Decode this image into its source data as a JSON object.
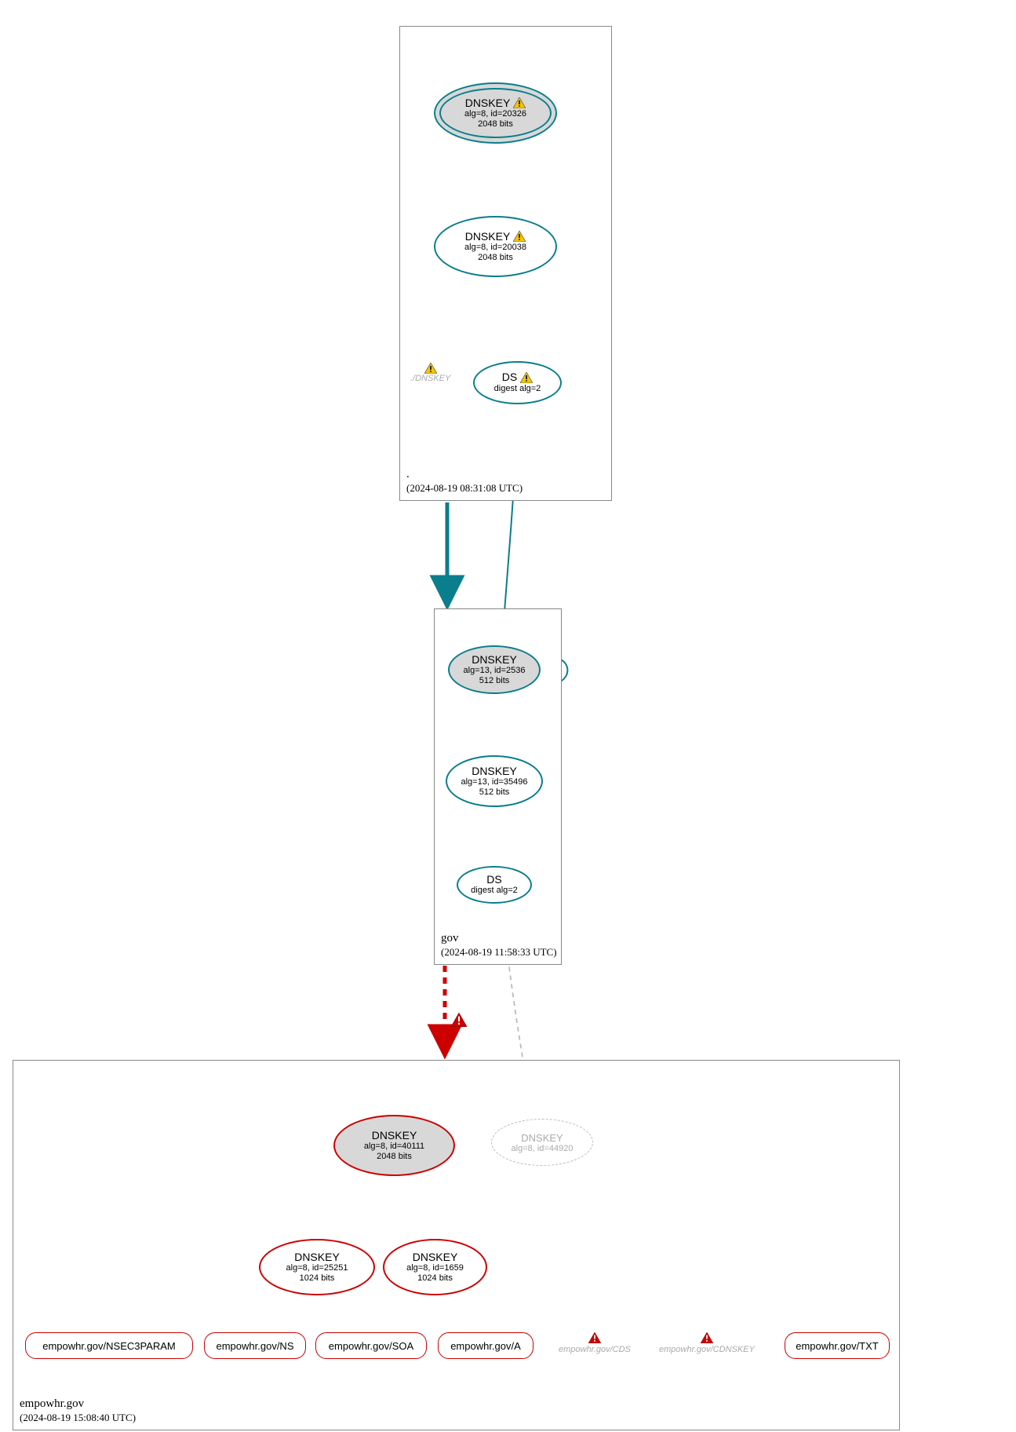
{
  "zones": {
    "root": {
      "name": ".",
      "timestamp": "(2024-08-19 08:31:08 UTC)"
    },
    "gov": {
      "name": "gov",
      "timestamp": "(2024-08-19 11:58:33 UTC)"
    },
    "empowhr": {
      "name": "empowhr.gov",
      "timestamp": "(2024-08-19 15:08:40 UTC)"
    }
  },
  "nodes": {
    "root_ksk": {
      "title": "DNSKEY",
      "line1": "alg=8, id=20326",
      "line2": "2048 bits",
      "warn": true
    },
    "root_zsk": {
      "title": "DNSKEY",
      "line1": "alg=8, id=20038",
      "line2": "2048 bits",
      "warn": true
    },
    "root_ds": {
      "title": "DS",
      "line1": "digest alg=2",
      "warn": true
    },
    "root_dnskey_label": "./DNSKEY",
    "gov_ksk": {
      "title": "DNSKEY",
      "line1": "alg=13, id=2536",
      "line2": "512 bits"
    },
    "gov_zsk": {
      "title": "DNSKEY",
      "line1": "alg=13, id=35496",
      "line2": "512 bits"
    },
    "gov_ds": {
      "title": "DS",
      "line1": "digest alg=2"
    },
    "emp_ksk": {
      "title": "DNSKEY",
      "line1": "alg=8, id=40111",
      "line2": "2048 bits"
    },
    "emp_zsk1": {
      "title": "DNSKEY",
      "line1": "alg=8, id=25251",
      "line2": "1024 bits"
    },
    "emp_zsk2": {
      "title": "DNSKEY",
      "line1": "alg=8, id=1659",
      "line2": "1024 bits"
    },
    "emp_ghost": {
      "title": "DNSKEY",
      "line1": "alg=8, id=44920"
    }
  },
  "rr": {
    "nsec3param": "empowhr.gov/NSEC3PARAM",
    "ns": "empowhr.gov/NS",
    "soa": "empowhr.gov/SOA",
    "a": "empowhr.gov/A",
    "txt": "empowhr.gov/TXT"
  },
  "errors": {
    "cds": "empowhr.gov/CDS",
    "cdnskey": "empowhr.gov/CDNSKEY"
  },
  "colors": {
    "teal": "#0a7e8c",
    "red": "#cc0000",
    "grey": "#bbbbbb"
  }
}
